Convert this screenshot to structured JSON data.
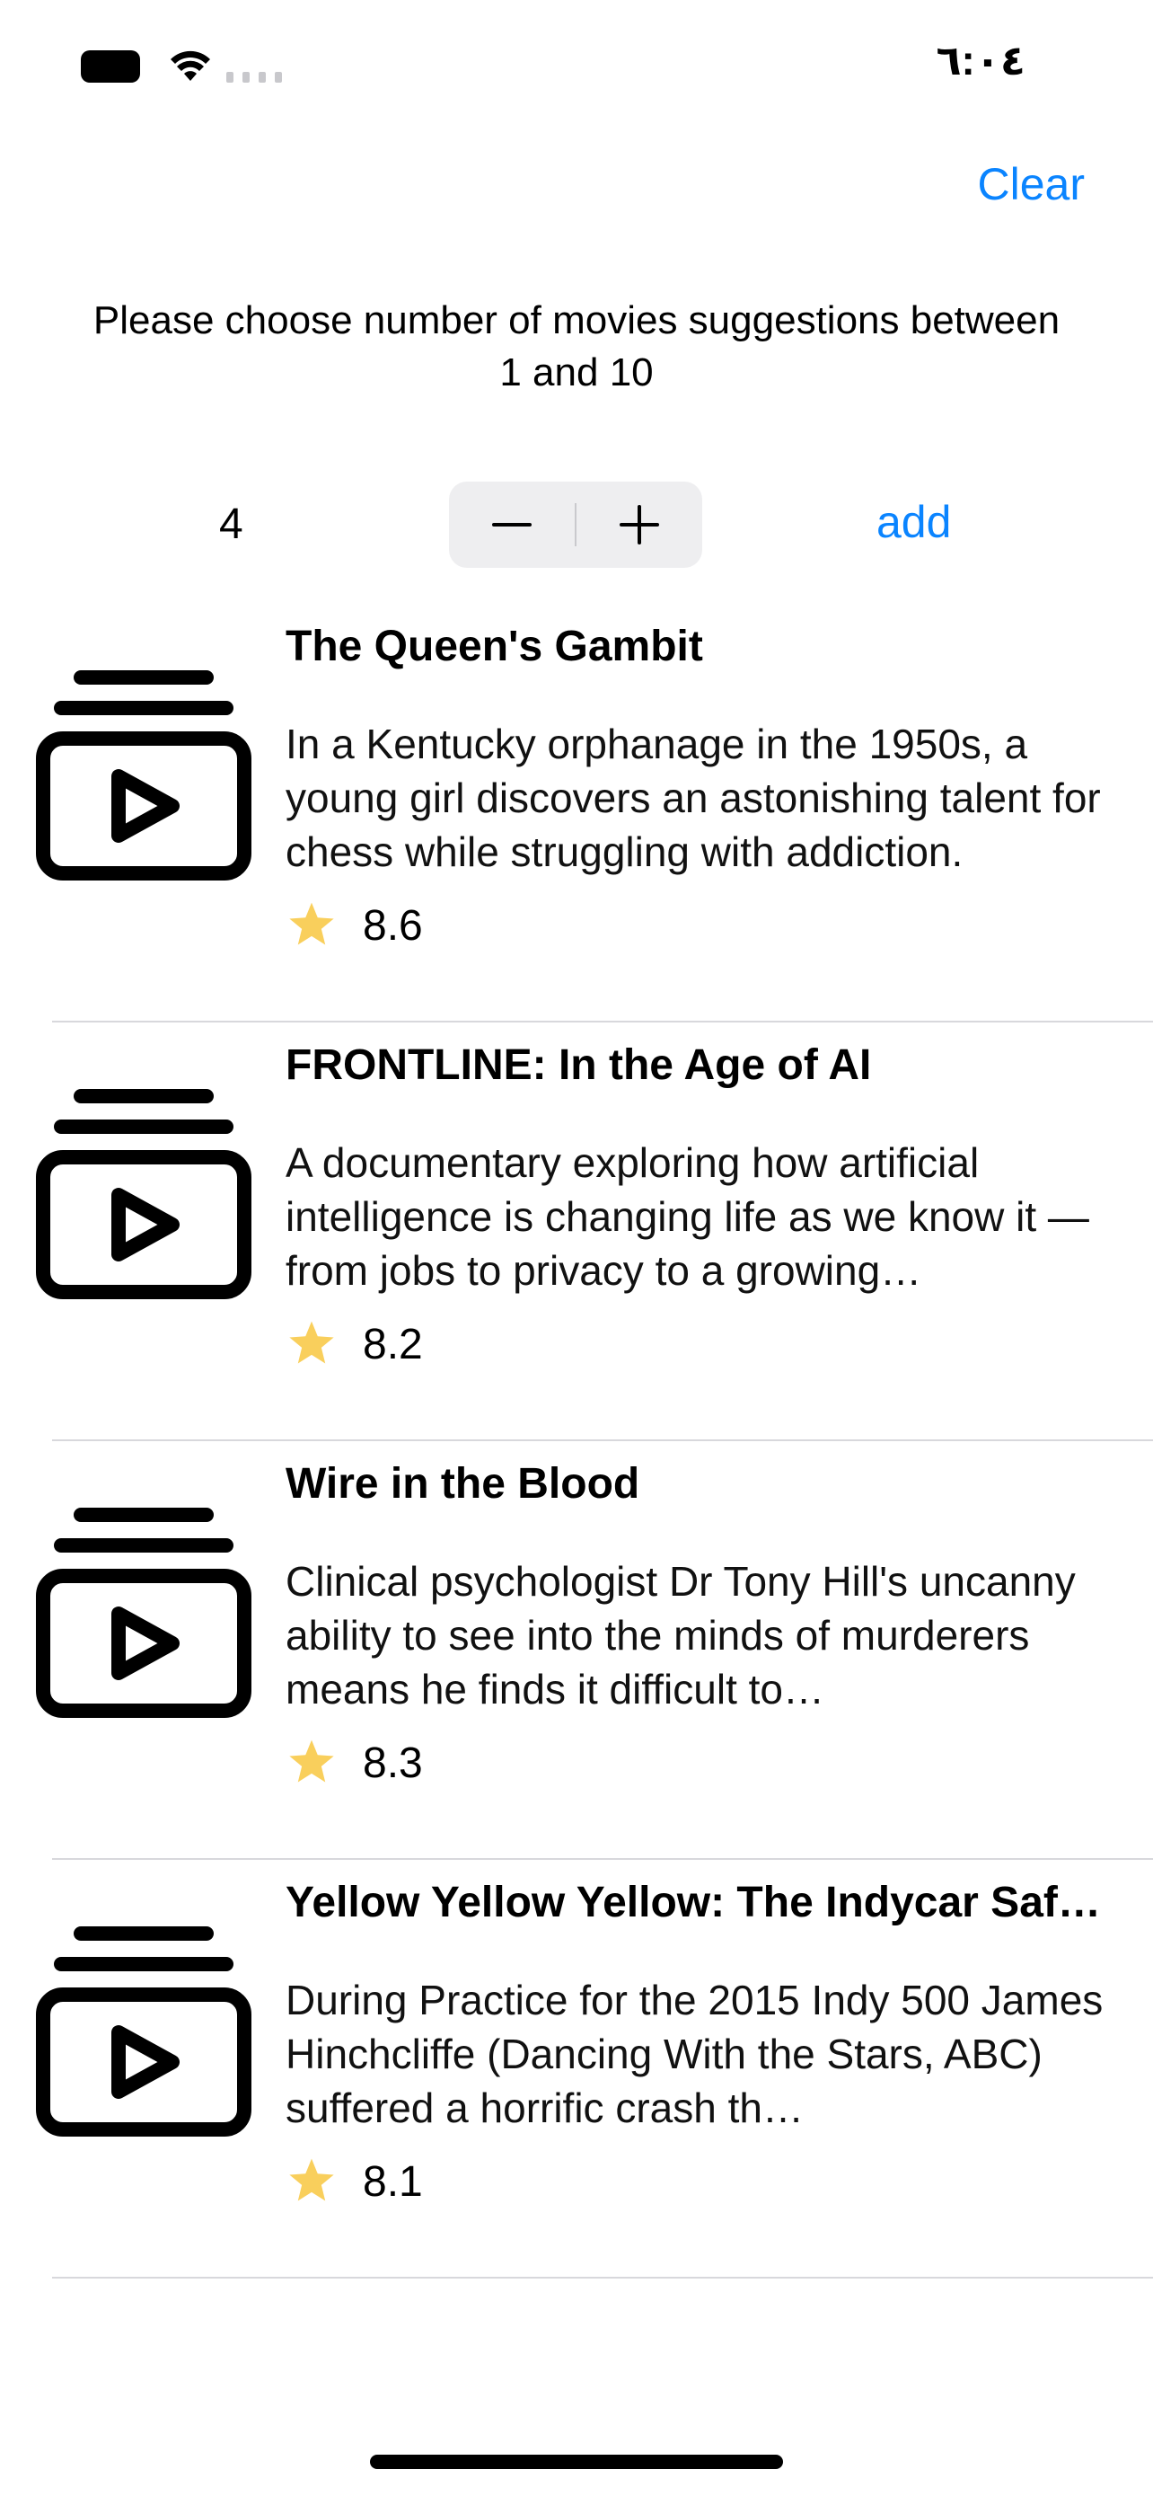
{
  "status_bar": {
    "time": "٦:٠٤"
  },
  "nav": {
    "clear_label": "Clear"
  },
  "prompt": "Please choose number of movies suggestions between 1 and 10",
  "stepper": {
    "value": "4",
    "minus_symbol": "−",
    "plus_symbol": "+",
    "add_label": "add"
  },
  "movies": [
    {
      "title": "The Queen's Gambit",
      "description": "In a Kentucky orphanage in the 1950s, a young girl discovers an astonishing talent for chess while struggling with addiction.",
      "rating": "8.6"
    },
    {
      "title": "FRONTLINE: In the Age of AI",
      "description": "A documentary exploring how artificial intelligence is changing life as we know it — from jobs to privacy to a growing…",
      "rating": "8.2"
    },
    {
      "title": "Wire in the Blood",
      "description": "Clinical psychologist Dr Tony Hill's uncanny ability to see into the minds of murderers means he finds it difficult to…",
      "rating": "8.3"
    },
    {
      "title": "Yellow Yellow Yellow: The Indycar Saf…",
      "description": "During Practice for the 2015 Indy 500 James Hinchcliffe (Dancing With the Stars, ABC) suffered a horrific crash th…",
      "rating": "8.1"
    }
  ],
  "colors": {
    "accent": "#0a84ff",
    "star": "#f9cf5c",
    "stepper_bg": "#eeeef0",
    "divider": "#d8d8dc"
  },
  "icons": {
    "movie_row_icon": "play-rectangle-on-rectangle-icon",
    "rating_icon": "star-icon"
  }
}
